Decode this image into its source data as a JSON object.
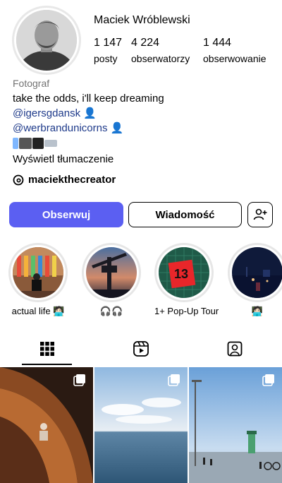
{
  "profile": {
    "name": "Maciek Wróblewski",
    "stats": [
      {
        "value": "1 147",
        "label": "posty"
      },
      {
        "value": "4 224",
        "label": "obserwatorzy"
      },
      {
        "value": "1 444",
        "label": "obserwowanie"
      }
    ]
  },
  "bio": {
    "category": "Fotograf",
    "text": "take the odds, i'll keep dreaming",
    "mentions": [
      "@igersgdansk",
      "@werbrandunicorns"
    ],
    "translate": "Wyświetl tłumaczenie"
  },
  "threads": {
    "handle": "maciekthecreator"
  },
  "actions": {
    "follow": "Obserwuj",
    "message": "Wiadomość",
    "add_user_icon": "add-person-icon"
  },
  "highlights": [
    {
      "label": "actual life 🧑🏻‍💻"
    },
    {
      "label": "🎧🎧"
    },
    {
      "label": "1+ Pop-Up Tour"
    },
    {
      "label": "🧑🏻‍💻"
    }
  ],
  "tabs": [
    {
      "name": "grid",
      "icon": "grid-icon"
    },
    {
      "name": "reels",
      "icon": "reels-icon"
    },
    {
      "name": "tagged",
      "icon": "tagged-icon"
    }
  ],
  "colors": {
    "follow": "#5b5ff2",
    "mention": "#1e3a8a"
  }
}
